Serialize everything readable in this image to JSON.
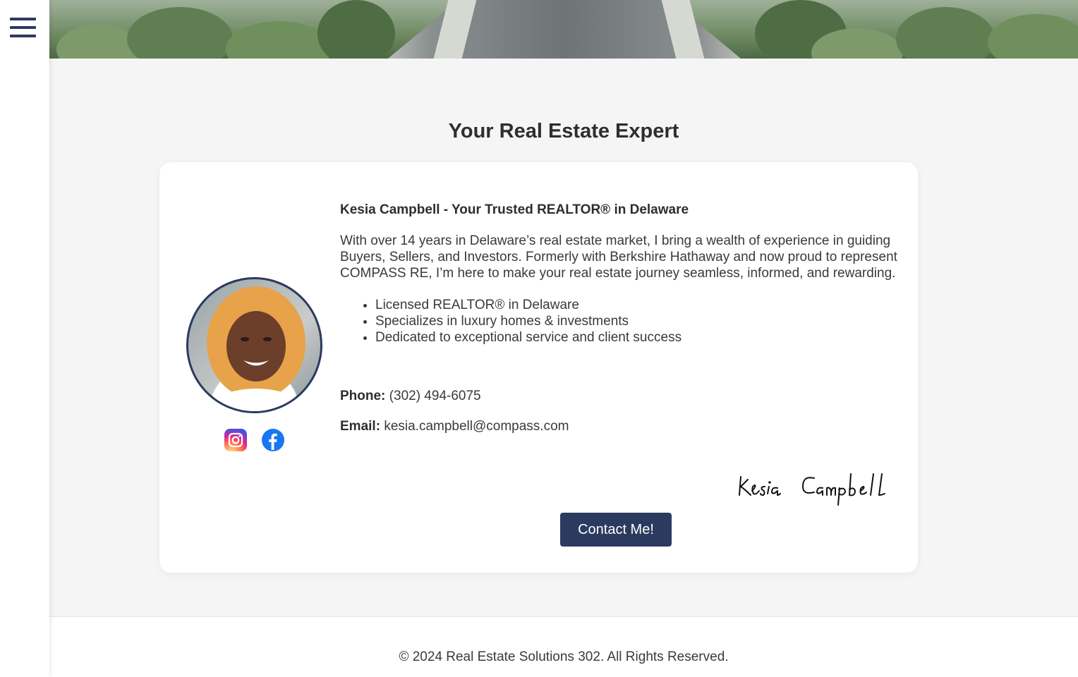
{
  "nav": {
    "menu_icon": "hamburger-menu-icon"
  },
  "section": {
    "title": "Your Real Estate Expert"
  },
  "profile": {
    "name_heading": "Kesia Campbell - Your Trusted REALTOR® in Delaware",
    "bio": "With over 14 years in Delaware’s real estate market, I bring a wealth of experience in guiding Buyers, Sellers, and Investors. Formerly with Berkshire Hathaway and now proud to represent COMPASS RE, I’m here to make your real estate journey seamless, informed, and rewarding.",
    "highlights": [
      "Licensed REALTOR® in Delaware",
      "Specializes in luxury homes & investments",
      "Dedicated to exceptional service and client success"
    ],
    "phone_label": "Phone:",
    "phone": "(302) 494-6075",
    "email_label": "Email:",
    "email": "kesia.campbell@compass.com",
    "signature": "Kesia Campbell",
    "social": [
      "instagram-icon",
      "facebook-icon"
    ]
  },
  "cta": {
    "label": "Contact Me!"
  },
  "footer": {
    "copyright": "© 2024 Real Estate Solutions 302. All Rights Reserved."
  },
  "colors": {
    "navy": "#2b3a5e",
    "background": "#f5f5f5",
    "card": "#ffffff"
  }
}
